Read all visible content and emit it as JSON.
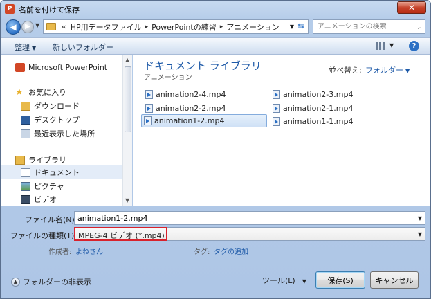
{
  "window": {
    "title": "名前を付けて保存",
    "app_icon_label": "P",
    "close_label": "✕"
  },
  "address": {
    "overflow": "«",
    "crumbs": [
      "HP用データファイル",
      "PowerPointの練習",
      "アニメーション"
    ],
    "separator": "▸",
    "search_placeholder": "アニメーションの検索"
  },
  "toolbar": {
    "organize": "整理",
    "new_folder": "新しいフォルダー",
    "help": "?"
  },
  "nav": {
    "items": [
      {
        "label": "Microsoft PowerPoint",
        "icon": "powerpoint-icon"
      },
      {
        "label": "お気に入り",
        "icon": "star-icon"
      },
      {
        "label": "ダウンロード",
        "icon": "download-icon"
      },
      {
        "label": "デスクトップ",
        "icon": "desktop-icon"
      },
      {
        "label": "最近表示した場所",
        "icon": "recent-places-icon"
      },
      {
        "label": "ライブラリ",
        "icon": "library-icon"
      },
      {
        "label": "ドキュメント",
        "icon": "documents-icon"
      },
      {
        "label": "ピクチャ",
        "icon": "pictures-icon"
      },
      {
        "label": "ビデオ",
        "icon": "videos-icon"
      }
    ]
  },
  "content": {
    "library_title": "ドキュメント ライブラリ",
    "library_subtitle": "アニメーション",
    "sort_label": "並べ替え:",
    "sort_value": "フォルダー",
    "files": [
      "animation2-4.mp4",
      "animation2-3.mp4",
      "animation2-2.mp4",
      "animation2-1.mp4",
      "animation1-2.mp4",
      "animation1-1.mp4"
    ],
    "selected_file": "animation1-2.mp4"
  },
  "form": {
    "filename_label": "ファイル名(N):",
    "filename_value": "animation1-2.mp4",
    "filetype_label": "ファイルの種類(T):",
    "filetype_value": "MPEG-4 ビデオ (*.mp4)",
    "author_label": "作成者:",
    "author_value": "よねさん",
    "tags_label": "タグ:",
    "tags_value": "タグの追加"
  },
  "footer": {
    "hide_folders": "フォルダーの非表示",
    "tools": "ツール(L)",
    "save": "保存(S)",
    "cancel": "キャンセル"
  },
  "colors": {
    "accent": "#1e5aa8",
    "highlight_border": "#d8222c",
    "selection": "#cfe1f6"
  }
}
